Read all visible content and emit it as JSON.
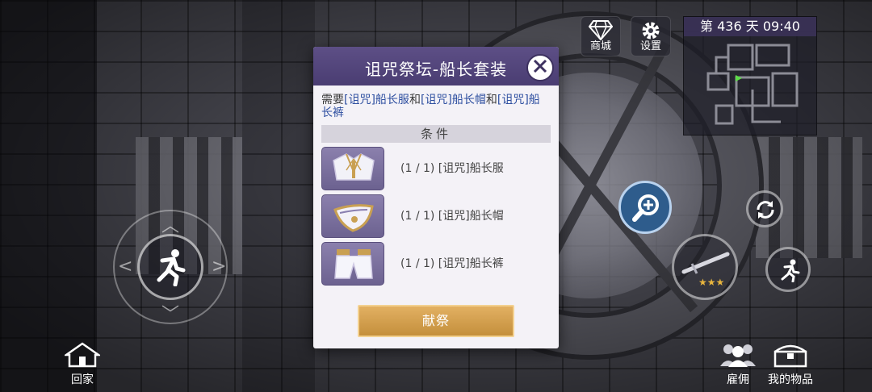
{
  "hud": {
    "shop_label": "商城",
    "settings_label": "设置",
    "day_time": "第 436 天  09:40"
  },
  "bottom": {
    "home_label": "回家",
    "hire_label": "雇佣",
    "items_label": "我的物品"
  },
  "dialog": {
    "title": "诅咒祭坛-船长套装",
    "requirement": {
      "prefix": "需要",
      "item1": "[诅咒]船长服",
      "join1": "和",
      "item2": "[诅咒]船长帽",
      "join2": "和",
      "item3": "[诅咒]船长裤"
    },
    "conditions_label": "条件",
    "items": [
      {
        "text": "(1 / 1) [诅咒]船长服",
        "icon": "captain-coat-icon"
      },
      {
        "text": "(1 / 1) [诅咒]船长帽",
        "icon": "captain-hat-icon"
      },
      {
        "text": "(1 / 1) [诅咒]船长裤",
        "icon": "captain-pants-icon"
      }
    ],
    "offer_label": "献祭"
  },
  "weapon": {
    "stars": "★★★"
  },
  "colors": {
    "header": "#4a3d72",
    "button": "#c48f3c",
    "highlight": "#2e4fa0"
  }
}
